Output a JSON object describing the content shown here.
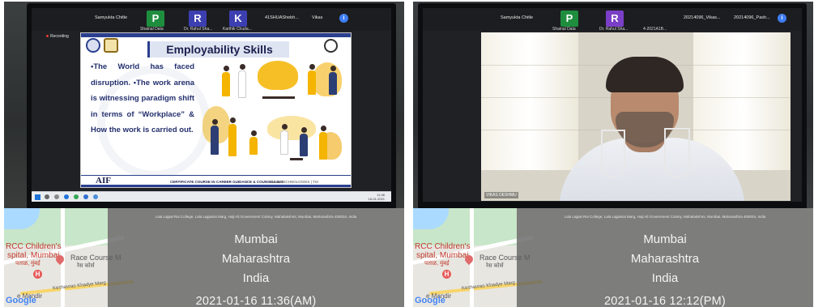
{
  "left": {
    "participants": {
      "names": [
        "Samyukta Chitle",
        "Shainal Data",
        "Dr. Rahul Sha...",
        "Karthik Chuda...",
        "41SHUAShebh...",
        "Vikas"
      ],
      "tile_letters": [
        "P",
        "R",
        "K"
      ],
      "tile_colors": [
        "#1e8e3e",
        "#3c3fb0",
        "#3c3fb0"
      ],
      "recording": "Recording"
    },
    "slide": {
      "title": "Employability Skills",
      "bullets": "•The World has faced disruption. •The work arena is witnessing paradigm shift in terms of “Workplace” & How the work is carried out.",
      "footer_logo": "AIF",
      "footer_course": "CERTIFICATE COURSE IN CAREER GUIDANCE & COUNSELLING",
      "footer_partner": "DELL TECHNOLOGIES | TSI"
    },
    "taskbar": {
      "time": "11:36",
      "date": "16-01-2021"
    },
    "stamp": {
      "address": "Lala Lajpat Rai College, Lala Lajpatrai Marg, Haji Ali Government Colony, Mahalakshmi, Mumbai, Maharashtra 400034, India",
      "city": "Mumbai",
      "state": "Maharashtra",
      "country": "India",
      "datetime": "2021-01-16  11:36(AM)"
    }
  },
  "right": {
    "participants": {
      "names": [
        "Samyukta Chitle",
        "Shainal Data",
        "Dr. Rahul Sha...",
        "4-2021A1B...",
        "20214096_Vikas...",
        "20214096_Pash..."
      ],
      "tile_letters": [
        "P",
        "R"
      ],
      "tile_colors": [
        "#1e8e3e",
        "#7b3fc7"
      ]
    },
    "video": {
      "label": "VIKAS DESHMU"
    },
    "stamp": {
      "address": "Lala Lajpat Rai College, Lala Lajpatrai Marg, Haji Ali Government Colony, Mahalakshmi, Mumbai, Maharashtra 400034, India",
      "city": "Mumbai",
      "state": "Maharashtra",
      "country": "India",
      "datetime": "2021-01-16  12:12(PM)"
    }
  },
  "map": {
    "labels": [
      "RCC Children's",
      "spital, Mumbai",
      "पताळ, मुंबई",
      "Race Course M",
      "रेस कोर्स",
      "Keshavrao Khadye Marg",
      "e Mandir"
    ],
    "brand": "Google"
  }
}
